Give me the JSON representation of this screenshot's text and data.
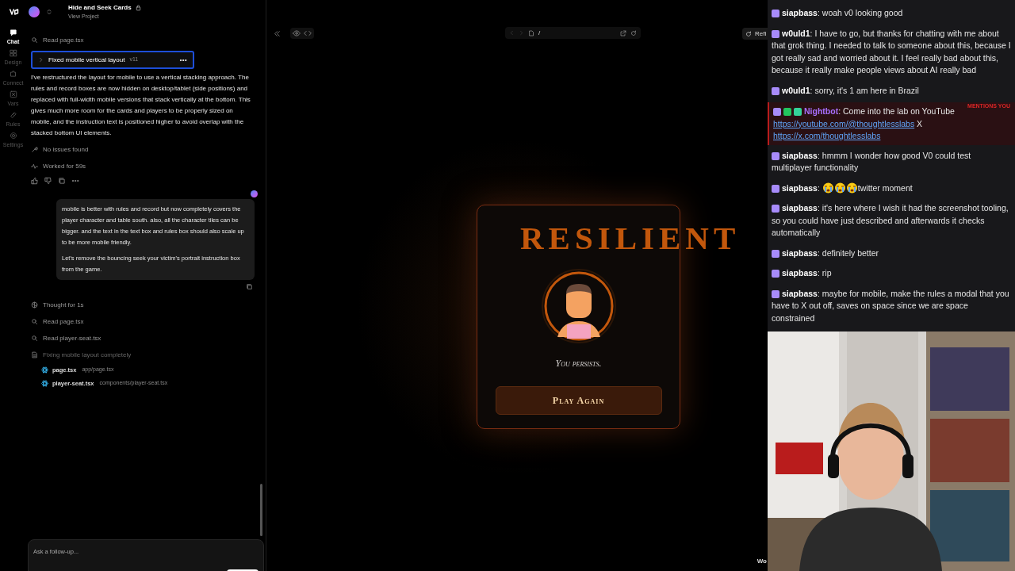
{
  "header": {
    "project": "Hide and Seek Cards",
    "subtitle": "View Project"
  },
  "rail": [
    {
      "kind": "chat",
      "label": "Chat",
      "selected": true
    },
    {
      "kind": "design",
      "label": "Design",
      "selected": false
    },
    {
      "kind": "connect",
      "label": "Connect",
      "selected": false
    },
    {
      "kind": "vars",
      "label": "Vars",
      "selected": false
    },
    {
      "kind": "rules",
      "label": "Rules",
      "selected": false
    },
    {
      "kind": "settings",
      "label": "Settings",
      "selected": false
    }
  ],
  "steps_top": [
    {
      "kind": "read",
      "text": "Read page.tsx"
    }
  ],
  "version_card": {
    "title": "Fixed mobile vertical layout",
    "version": "v11",
    "selected": true
  },
  "reply": "I've restructured the layout for mobile to use a vertical stacking approach. The rules and record boxes are now hidden on desktop/tablet (side positions) and replaced with full-width mobile versions that stack vertically at the bottom. This gives much more room for the cards and players to be properly sized on mobile, and the instruction text is positioned higher to avoid overlap with the stacked bottom UI elements.",
  "status": [
    {
      "kind": "check",
      "text": "No issues found"
    },
    {
      "kind": "worked",
      "text": "Worked for 59s"
    }
  ],
  "user_message": [
    "mobile is better with rules and record but now completely covers the player character and table south. also, all the character tiles can be bigger. and the text in the text box and rules box should also scale up to be more mobile friendly.",
    "Let's remove the bouncing seek your victim's portrait instruction box from the game."
  ],
  "steps": [
    {
      "kind": "thought",
      "text": "Thought for 1s"
    },
    {
      "kind": "read",
      "text": "Read page.tsx"
    },
    {
      "kind": "read",
      "text": "Read player-seat.tsx"
    },
    {
      "kind": "edit",
      "text": "Fixing mobile layout completely",
      "children": [
        {
          "name": "page.tsx",
          "path": "app/page.tsx"
        },
        {
          "name": "player-seat.tsx",
          "path": "components/player-seat.tsx"
        }
      ]
    }
  ],
  "composer": {
    "placeholder": "Ask a follow-up..."
  },
  "preview": {
    "path": "/",
    "title": "RESILIENT",
    "caption": "You persists.",
    "button": "Play Again"
  },
  "refresh_label": "Refi",
  "chat": [
    {
      "user": "siapbass",
      "separator": ":",
      "color": "#ffffff",
      "highlighted": false,
      "badges": [
        {
          "color": "#a78bfa"
        }
      ],
      "segments": [
        {
          "kind": "text",
          "text": "woah v0 looking good"
        }
      ]
    },
    {
      "user": "w0uld1",
      "separator": ":",
      "color": "#ffffff",
      "highlighted": false,
      "badges": [
        {
          "color": "#a78bfa"
        }
      ],
      "segments": [
        {
          "kind": "text",
          "text": "I have to go, but thanks for chatting with me about that grok thing. I needed to talk to someone about this, because I got really sad and worried about it. I feel really bad about this, because it really make people views about AI really bad"
        }
      ]
    },
    {
      "user": "w0uld1",
      "separator": ":",
      "color": "#ffffff",
      "highlighted": false,
      "badges": [
        {
          "color": "#a78bfa"
        }
      ],
      "segments": [
        {
          "kind": "text",
          "text": "sorry, it's 1 am here in Brazil"
        }
      ]
    },
    {
      "user": "Nightbot",
      "separator": ":",
      "color": "#a970ff",
      "highlighted": true,
      "badges": [
        {
          "color": "#a78bfa"
        },
        {
          "color": "#22c55e"
        },
        {
          "color": "#34d399"
        }
      ],
      "segments": [
        {
          "kind": "text",
          "text": "Come into the lab on YouTube"
        },
        {
          "kind": "link",
          "text": "https://youtube.com/@thoughtlesslabs"
        },
        {
          "kind": "text",
          "text": "X"
        },
        {
          "kind": "link",
          "text": "https://x.com/thoughtlesslabs"
        }
      ]
    },
    {
      "user": "siapbass",
      "separator": ":",
      "color": "#ffffff",
      "highlighted": false,
      "badges": [
        {
          "color": "#a78bfa"
        }
      ],
      "segments": [
        {
          "kind": "text",
          "text": "hmmm I wonder how good V0 could test multiplayer functionality"
        }
      ]
    },
    {
      "user": "siapbass",
      "separator": ":",
      "color": "#ffffff",
      "highlighted": false,
      "badges": [
        {
          "color": "#a78bfa"
        }
      ],
      "segments": [
        {
          "kind": "emote"
        },
        {
          "kind": "emote"
        },
        {
          "kind": "emote"
        },
        {
          "kind": "text",
          "text": "twitter moment"
        }
      ]
    },
    {
      "user": "siapbass",
      "separator": ":",
      "color": "#ffffff",
      "highlighted": false,
      "badges": [
        {
          "color": "#a78bfa"
        }
      ],
      "segments": [
        {
          "kind": "text",
          "text": "it's here where I wish it had the screenshot tooling, so you could have just described and afterwards it checks automatically"
        }
      ]
    },
    {
      "user": "siapbass",
      "separator": ":",
      "color": "#ffffff",
      "highlighted": false,
      "badges": [
        {
          "color": "#a78bfa"
        }
      ],
      "segments": [
        {
          "kind": "text",
          "text": "definitely better"
        }
      ]
    },
    {
      "user": "siapbass",
      "separator": ":",
      "color": "#ffffff",
      "highlighted": false,
      "badges": [
        {
          "color": "#a78bfa"
        }
      ],
      "segments": [
        {
          "kind": "text",
          "text": "rip"
        }
      ]
    },
    {
      "user": "siapbass",
      "separator": ":",
      "color": "#ffffff",
      "highlighted": false,
      "badges": [
        {
          "color": "#a78bfa"
        }
      ],
      "segments": [
        {
          "kind": "text",
          "text": "maybe for mobile, make the rules a modal that you have to X out off, saves on space since we are space constrained"
        }
      ]
    }
  ],
  "mention_label": "MENTIONS YOU",
  "corner_text": "Wo"
}
